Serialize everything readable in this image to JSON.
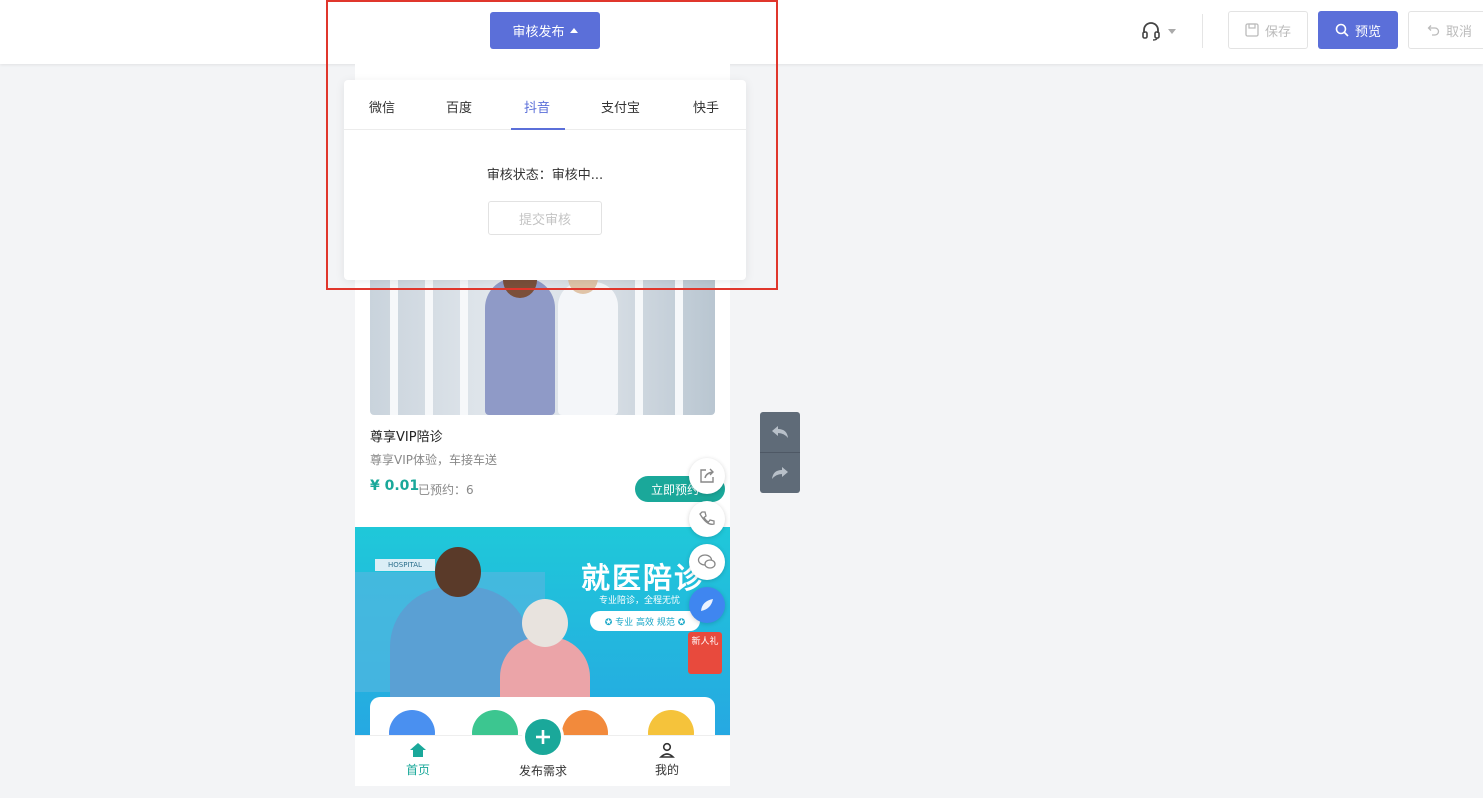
{
  "header": {
    "review_publish_label": "审核发布",
    "save_label": "保存",
    "preview_label": "预览",
    "cancel_label": "取消"
  },
  "review_popover": {
    "tabs": [
      {
        "label": "微信"
      },
      {
        "label": "百度"
      },
      {
        "label": "抖音"
      },
      {
        "label": "支付宝"
      },
      {
        "label": "快手"
      }
    ],
    "active_tab": "抖音",
    "status_text": "审核状态：审核中...",
    "submit_label": "提交审核"
  },
  "phone": {
    "service_card": {
      "title": "尊享VIP陪诊",
      "subtitle": "尊享VIP体验，车接车送",
      "price": "¥ 0.01",
      "booked": "已预约：6",
      "book_label": "立即预约"
    },
    "banner": {
      "title": "就医陪诊",
      "subtitle": "专业陪诊，全程无忧",
      "pill": "✪ 专业  高效  规范 ✪",
      "gift_label": "新人礼",
      "sign": "HOSPITAL"
    },
    "tabbar": {
      "home": "首页",
      "publish": "发布需求",
      "mine": "我的"
    }
  },
  "colors": {
    "accent": "#5b6fd9",
    "teal": "#1aa89a",
    "highlight": "#e0362c"
  }
}
